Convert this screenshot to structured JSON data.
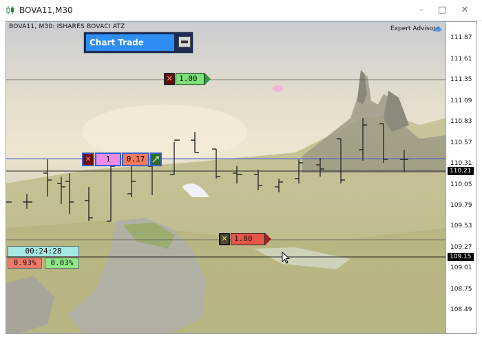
{
  "window": {
    "title": "BOVA11,M30",
    "controls": {
      "close": "✕",
      "minimize": "–",
      "maximize": "□"
    }
  },
  "chart": {
    "symbol_info": "BOVA11, M30:  ISHARES BOVACI  ATZ",
    "expert_advisor_label": "Expert Advisor",
    "price_levels": [
      "111.87",
      "111.61",
      "111.35",
      "111.09",
      "110.83",
      "110.57",
      "110.31",
      "110.05",
      "109.79",
      "109.53",
      "109.27",
      "109.01",
      "108.75",
      "108.49"
    ],
    "current_price_tag": "110.21",
    "cursor_price_tag": "109.15"
  },
  "chart_trade": {
    "title": "Chart Trade"
  },
  "orders": {
    "take_profit": {
      "value": "1.00",
      "color": "#7ee07a"
    },
    "stop_loss": {
      "value": "1.00",
      "color": "#e8564a"
    },
    "position": {
      "volume": "1",
      "profit": "0.17",
      "volume_color": "#f08ce8",
      "profit_color": "#f07a5a"
    }
  },
  "stats": {
    "timer": "00:24:28",
    "change_left": "0.93%",
    "change_right": "0.03%",
    "change_left_color": "#f07a6a",
    "change_right_color": "#8fe88a"
  },
  "icons": {
    "app": "chart-candles-icon",
    "ea": "hat-icon",
    "cancel": "close-x-icon",
    "cursor": "arrow-cursor-icon"
  }
}
